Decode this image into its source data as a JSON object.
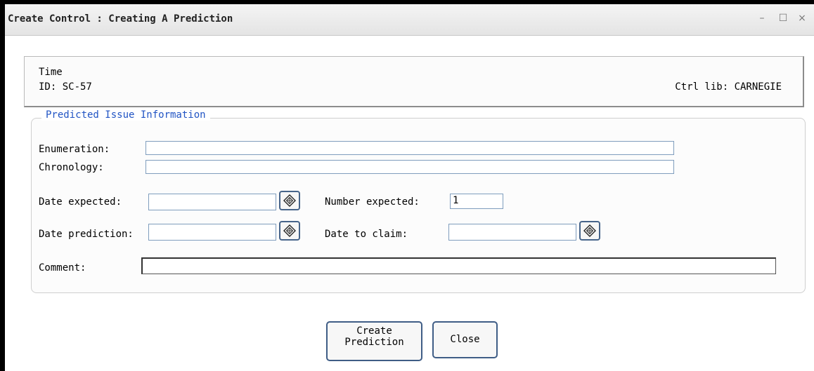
{
  "window": {
    "title": "Create Control : Creating A Prediction",
    "minimize": "–",
    "maximize": "☐",
    "close": "×"
  },
  "info": {
    "type": "Time",
    "id": "ID: SC-57",
    "ctrl_lib": "Ctrl lib: CARNEGIE"
  },
  "form": {
    "legend": "Predicted Issue Information",
    "enumeration_label": "Enumeration:",
    "enumeration_value": "",
    "chronology_label": "Chronology:",
    "chronology_value": "",
    "date_expected_label": "Date expected:",
    "date_expected_value": "",
    "number_expected_label": "Number expected:",
    "number_expected_value": "1",
    "date_prediction_label": "Date prediction:",
    "date_prediction_value": "",
    "date_to_claim_label": "Date to claim:",
    "date_to_claim_value": "",
    "comment_label": "Comment:",
    "comment_value": ""
  },
  "buttons": {
    "create_line1": "Create",
    "create_line2": "Prediction",
    "close": "Close"
  },
  "icons": {
    "calendar": "calendar-diamond-icon"
  },
  "colors": {
    "legend": "#2154c4",
    "button_border": "#3f5d86",
    "field_border": "#7f9dbd"
  }
}
